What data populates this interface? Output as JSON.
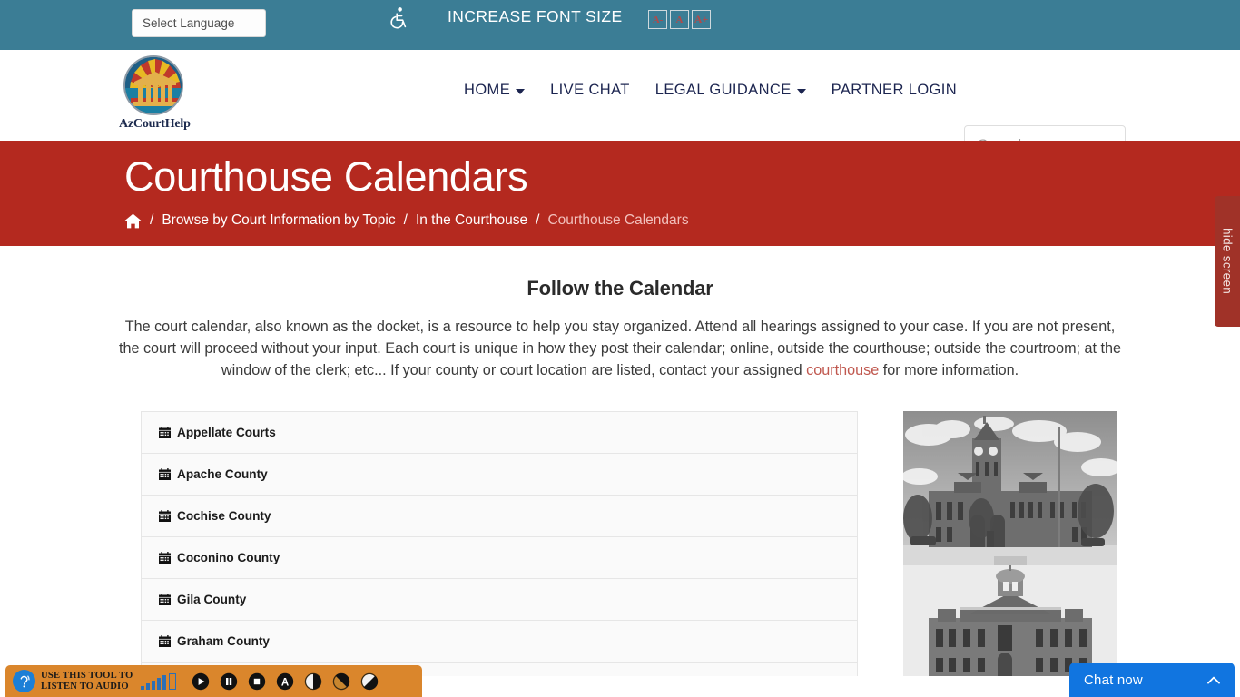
{
  "topbar": {
    "language_selector": "Select Language",
    "accessibility_icon": "wheelchair-icon",
    "font_size_label": "INCREASE FONT SIZE",
    "font_buttons": [
      {
        "label": "A-",
        "name": "font-decrease"
      },
      {
        "label": "A",
        "name": "font-reset"
      },
      {
        "label": "A+",
        "name": "font-increase"
      }
    ],
    "bg_color": "#3b7d95"
  },
  "header": {
    "logo_text": "AzCourtHelp",
    "nav": [
      {
        "label": "HOME",
        "has_caret": true
      },
      {
        "label": "LIVE CHAT",
        "has_caret": false
      },
      {
        "label": "LEGAL GUIDANCE",
        "has_caret": true
      },
      {
        "label": "PARTNER LOGIN",
        "has_caret": false
      }
    ],
    "search_placeholder": "Search ...",
    "search_value": ""
  },
  "banner": {
    "title": "Courthouse Calendars",
    "bg_color": "#b4291f",
    "breadcrumb": {
      "home_icon": "home-icon",
      "items": [
        {
          "label": "Browse by Court Information by Topic",
          "current": false
        },
        {
          "label": "In the Courthouse",
          "current": false
        },
        {
          "label": "Courthouse Calendars",
          "current": true
        }
      ],
      "separator": "/"
    }
  },
  "hide_screen_tab": {
    "label": "hide screen"
  },
  "content": {
    "section_title": "Follow the Calendar",
    "intro_part1": "The court calendar, also known as the docket, is a resource to help you stay organized. Attend all hearings assigned to your case.  If you are not present, the court will proceed without your input.  Each court is unique in how they post their calendar; online, outside the courthouse; outside the courtroom; at the window of the clerk; etc...  If your county or court location are listed, contact your assigned ",
    "intro_link": "courthouse",
    "intro_part2": " for more information.",
    "link_color": "#c0584f"
  },
  "accordion": {
    "items": [
      {
        "label": "Appellate Courts",
        "icon": "calendar-icon"
      },
      {
        "label": "Apache County",
        "icon": "calendar-icon"
      },
      {
        "label": "Cochise County",
        "icon": "calendar-icon"
      },
      {
        "label": "Coconino County",
        "icon": "calendar-icon"
      },
      {
        "label": "Gila County",
        "icon": "calendar-icon"
      },
      {
        "label": "Graham County",
        "icon": "calendar-icon"
      }
    ]
  },
  "photos": [
    {
      "name": "historic-courthouse-photo-1",
      "alt": "Historic courthouse with clock tower, black and white"
    },
    {
      "name": "historic-courthouse-photo-2",
      "alt": "Historic courthouse with cupola, black and white"
    }
  ],
  "audio_toolbar": {
    "ear_icon": "ear-icon",
    "label_line1": "USE THIS TOOL TO",
    "label_line2": "LISTEN TO AUDIO",
    "bg_color": "#da862c",
    "volume_icon": "volume-bars-icon",
    "controls": [
      {
        "name": "play-button",
        "icon": "play-icon"
      },
      {
        "name": "pause-button",
        "icon": "pause-icon"
      },
      {
        "name": "stop-button",
        "icon": "stop-icon"
      },
      {
        "name": "font-button",
        "icon": "letter-a-icon"
      },
      {
        "name": "contrast-button",
        "icon": "contrast-icon"
      },
      {
        "name": "contrast-alt-button",
        "icon": "contrast-alt-icon"
      },
      {
        "name": "contrast-invert-button",
        "icon": "contrast-invert-icon"
      }
    ]
  },
  "chat_widget": {
    "label": "Chat now",
    "icon": "chevron-up-icon",
    "bg_color": "#1175e0"
  }
}
